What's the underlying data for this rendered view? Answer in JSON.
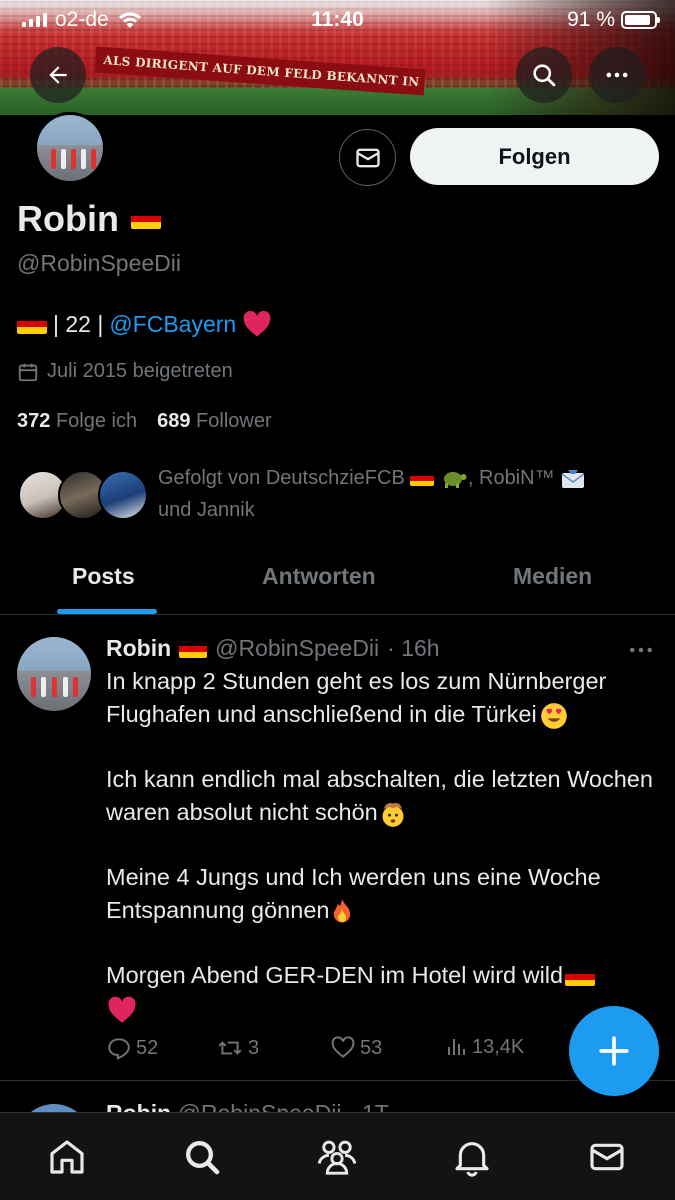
{
  "status_bar": {
    "carrier": "o2-de",
    "time": "11:40",
    "battery_text": "91 %",
    "battery_level": 0.91
  },
  "banner": {
    "slogan": "ALS DIRIGENT AUF DEM FELD BEKANNT IN DER GANZEN WELT!"
  },
  "profile": {
    "name": "Robin",
    "handle": "@RobinSpeeDii",
    "bio_age": "| 22 |",
    "bio_link": "@FCBayern",
    "joined": "Juli 2015 beigetreten",
    "following_count": "372",
    "following_label": "Folge ich",
    "followers_count": "689",
    "followers_label": "Follower",
    "followed_by_prefix": "Gefolgt von DeutschzieFCB",
    "followed_by_mid": ", RobiN™",
    "followed_by_suffix": "und Jannik",
    "follow_button": "Folgen"
  },
  "tabs": [
    {
      "label": "Posts",
      "active": true
    },
    {
      "label": "Antworten",
      "active": false
    },
    {
      "label": "Medien",
      "active": false
    }
  ],
  "post": {
    "name": "Robin",
    "handle": "@RobinSpeeDii",
    "time": "· 16h",
    "line1": "In knapp 2 Stunden geht es los zum Nürnberger Flughafen und anschließend in die Türkei",
    "line2": "Ich kann endlich mal abschalten, die letzten Wochen waren absolut nicht schön",
    "line3": "Meine 4 Jungs und Ich werden uns eine Woche Entspannung gönnen",
    "line4": "Morgen Abend GER-DEN im Hotel wird wild",
    "replies": "52",
    "reposts": "3",
    "likes": "53",
    "views": "13,4K"
  },
  "next_post": {
    "name": "Robin",
    "handle": "@RobinSpeeDii · 1T"
  },
  "icons": {
    "back": "arrow-left-icon",
    "search": "search-icon",
    "more": "more-horizontal-icon",
    "mail": "mail-icon",
    "calendar": "calendar-icon",
    "compose": "plus-icon"
  },
  "colors": {
    "accent": "#1d9bf0",
    "background": "#000000",
    "muted": "#71767b",
    "heart": "#e0245e"
  }
}
